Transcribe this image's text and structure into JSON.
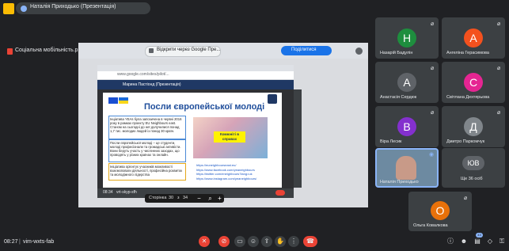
{
  "top": {
    "presenter_title": "Наталія Приходько (Презентація)"
  },
  "presentation": {
    "file_name": "Соціальна мобільність.pptx",
    "share_banner": "Відкрити через Google Пре...",
    "share_stop": "Поділитися",
    "url": "www.google.com/sites/pilot/...",
    "ppt_header": "Марина Пастіонд (Презентація)",
    "slide_title": "Посли європейської молоді",
    "box1": "Інціатива YEAs була запозичена в червні 2016 року в рамках проекту EU Neighbours east. Станом на сьогодні до неї долучилися понад 1,7 тис. молодих людей із понад 30 країн.",
    "box2": "Посли європейської молоді – це студенти, молоді професіонали та громадські активісти. Вони беруть участь у численних заходах, що проводять у різних країнах та онлайн.",
    "box3": "Ініціатива орієнтує учасників можливості взаємоповаги діяльності, професійна розвиток та молодіжного лідерства",
    "photo_badge": "Комюніті в справах",
    "links": [
      "https://euneighbourseast.eu/",
      "https://www.facebook.com/yeaneighbours",
      "https://twitter.com/eneighbours?lang=uk",
      "https://www.instagram.com/yeaneighbours/"
    ],
    "page_label": "Сторінка",
    "page_current": "30",
    "page_of": "з",
    "page_total": "34",
    "ppt_time": "08:34",
    "ppt_code": "vrt-skyp-sfh"
  },
  "participants": [
    {
      "name": "Назарій Бадулін",
      "initial": "Н",
      "color": "#1e8e3e"
    },
    {
      "name": "Ангеліна Герасимова",
      "initial": "А",
      "color": "#f4511e"
    },
    {
      "name": "Анастасія Сердюк",
      "initial": "А",
      "color": "#5f6368"
    },
    {
      "name": "Світлана Дехтярьова",
      "initial": "С",
      "color": "#e52592"
    },
    {
      "name": "Віра Лесик",
      "initial": "В",
      "color": "#8430ce"
    },
    {
      "name": "Дмитро Паркомчук",
      "initial": "Д",
      "color": "#80868b"
    },
    {
      "name": "Наталія Приходько",
      "initial": "",
      "color": "#1e3c55"
    },
    {
      "name": "Ще 36 осіб",
      "initial": "ЮВ",
      "color": "#5f6368"
    },
    {
      "name": "Ольга Ковалкова",
      "initial": "О",
      "color": "#e8710a"
    }
  ],
  "bottom": {
    "time": "08:27",
    "separator": "|",
    "meeting_code": "vim-wxts-fab",
    "participants_count": "43"
  },
  "icons": {
    "mic_off": "mic-off-icon",
    "cam_off": "camera-off-icon",
    "captions": "captions-icon",
    "emoji": "emoji-icon",
    "present": "present-icon",
    "raise_hand": "raise-hand-icon",
    "more": "more-icon",
    "leave": "leave-call-icon",
    "info": "info-icon",
    "people": "people-icon",
    "chat": "chat-icon",
    "activities": "activities-icon",
    "lock": "host-controls-icon"
  }
}
